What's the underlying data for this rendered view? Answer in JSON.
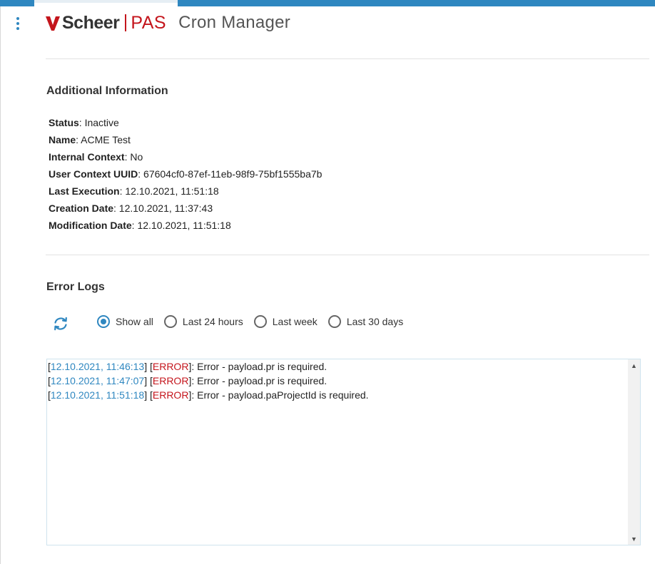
{
  "header": {
    "brand_name": "Scheer",
    "brand_product": "PAS",
    "app_title": "Cron Manager"
  },
  "info": {
    "heading": "Additional Information",
    "rows": [
      {
        "label": "Status",
        "value": ": Inactive"
      },
      {
        "label": "Name",
        "value": ": ACME Test"
      },
      {
        "label": "Internal Context",
        "value": ": No"
      },
      {
        "label": "User Context UUID",
        "value": ": 67604cf0-87ef-11eb-98f9-75bf1555ba7b"
      },
      {
        "label": "Last Execution",
        "value": ": 12.10.2021, 11:51:18"
      },
      {
        "label": "Creation Date",
        "value": ": 12.10.2021, 11:37:43"
      },
      {
        "label": "Modification Date",
        "value": ": 12.10.2021, 11:51:18"
      }
    ]
  },
  "errors": {
    "heading": "Error Logs",
    "filters": [
      {
        "label": "Show all",
        "checked": true
      },
      {
        "label": "Last 24 hours",
        "checked": false
      },
      {
        "label": "Last week",
        "checked": false
      },
      {
        "label": "Last 30 days",
        "checked": false
      }
    ],
    "logs": [
      {
        "timestamp": "12.10.2021, 11:46:13",
        "level": "ERROR",
        "message": ": Error - payload.pr is required."
      },
      {
        "timestamp": "12.10.2021, 11:47:07",
        "level": "ERROR",
        "message": ": Error - payload.pr is required."
      },
      {
        "timestamp": "12.10.2021, 11:51:18",
        "level": "ERROR",
        "message": ": Error - payload.paProjectId is required."
      }
    ]
  },
  "colors": {
    "accent": "#2f87c0",
    "brand_red": "#c4151c"
  },
  "icons": {
    "menu": "kebab-menu-icon",
    "refresh": "refresh-icon"
  }
}
